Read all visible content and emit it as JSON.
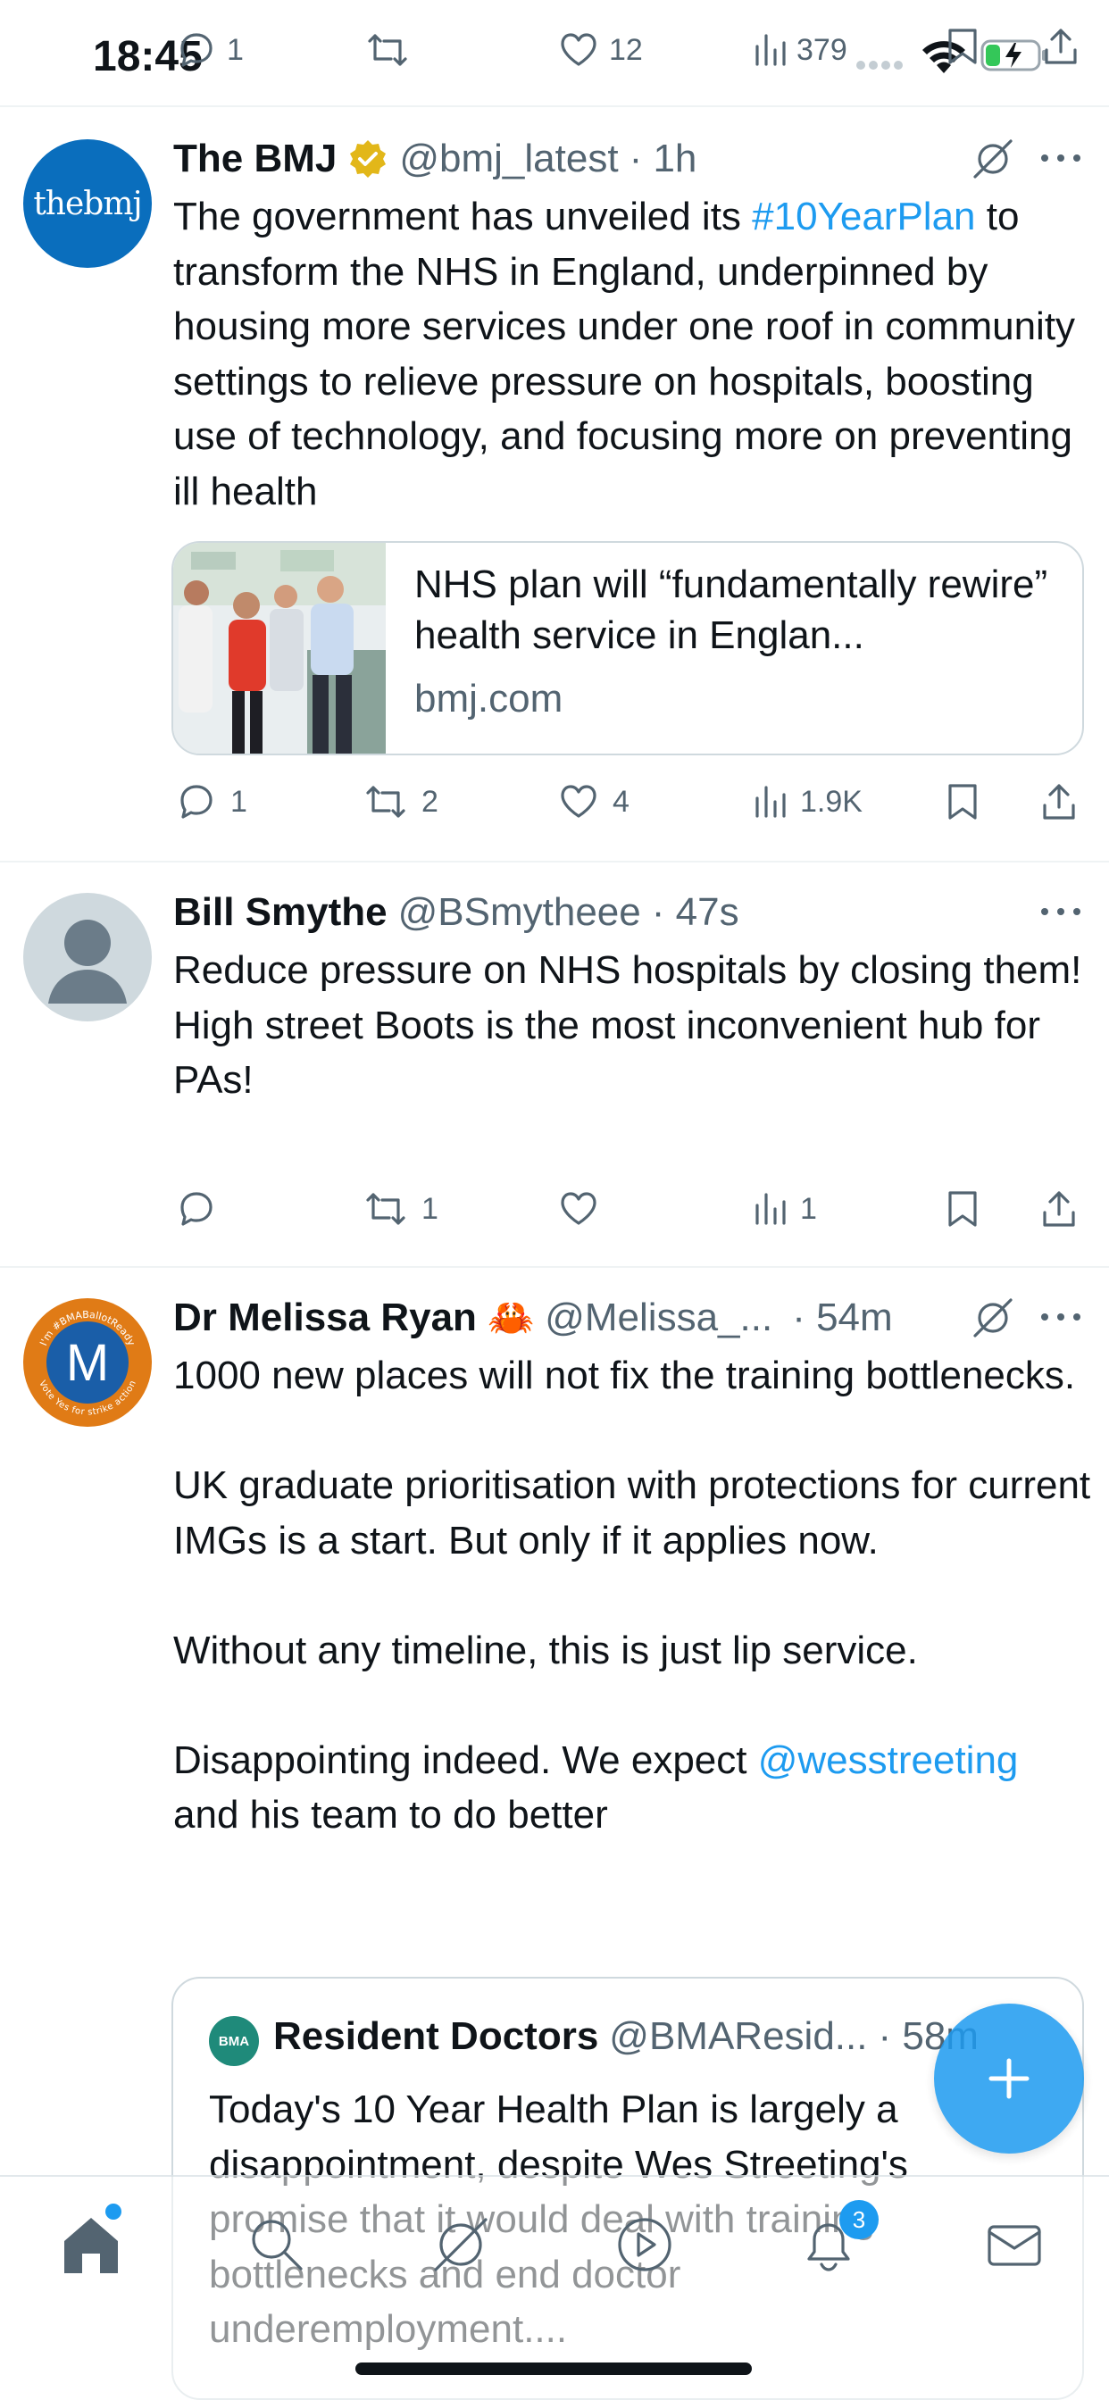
{
  "status_bar": {
    "time": "18:45"
  },
  "previous_post_actions": {
    "replies": "1",
    "likes": "12",
    "views": "379"
  },
  "posts": [
    {
      "name": "The BMJ",
      "handle": "@bmj_latest",
      "time": "· 1h",
      "avatar_text": "thebmj",
      "text_before_hashtag": "The government has unveiled its ",
      "hashtag": "#10YearPlan",
      "text_after_hashtag": " to transform the NHS in England, underpinned by housing more services under one roof in community settings to relieve pressure on hospitals, boosting use of technology, and focusing more on preventing ill health",
      "card": {
        "title": "NHS plan will “fundamentally rewire” health service in Englan...",
        "domain": "bmj.com"
      },
      "actions": {
        "replies": "1",
        "reposts": "2",
        "likes": "4",
        "views": "1.9K"
      }
    },
    {
      "name": "Bill Smythe",
      "handle": "@BSmytheee",
      "time": "· 47s",
      "line1": "Reduce pressure on NHS hospitals by closing them!",
      "line2": "High street Boots is the most inconvenient hub for PAs!",
      "actions": {
        "reposts": "1",
        "views": "1"
      }
    },
    {
      "name": "Dr Melissa Ryan",
      "emoji": "🦀",
      "handle": "@Melissa_...",
      "time": "· 54m",
      "avatar_letter": "M",
      "avatar_ring_top": "I'm #BMABallotReady",
      "avatar_ring_bottom": "Vote Yes for strike action",
      "para1": "1000 new places will not fix the training bottlenecks.",
      "para2": "UK graduate prioritisation with protections for current IMGs is a start. But only if it applies now.",
      "para3": "Without any timeline, this is just lip service.",
      "para4_before_mention": "Disappointing indeed. We expect ",
      "mention": "@wesstreeting",
      "para4_after_mention": " and his team to do better",
      "quote": {
        "avatar_text": "BMA",
        "name": "Resident Doctors",
        "handle": "@BMAResid...",
        "time": "· 58m",
        "text": "Today's 10 Year Health Plan is largely a disappointment, despite Wes Streeting's promise that it would deal with training bottlenecks and end doctor underemployment...."
      }
    }
  ],
  "tab_bar": {
    "notifications_badge": "3"
  },
  "colors": {
    "accent": "#1d9bf0",
    "repost_active": "#00ba7c",
    "muted": "#536471",
    "verified": "#e2b719"
  }
}
